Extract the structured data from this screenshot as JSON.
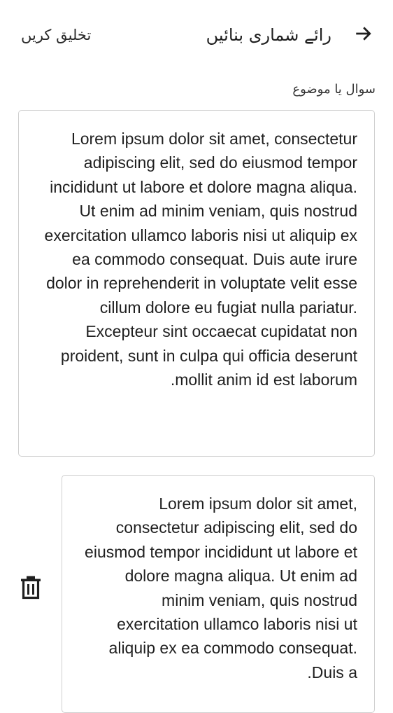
{
  "header": {
    "back_icon": "arrow-right-icon",
    "title": "رائے شماری بنائیں",
    "create_label": "تخلیق کریں"
  },
  "question": {
    "label": "سوال یا موضوع",
    "text": "Lorem ipsum dolor sit amet, consectetur adipiscing elit, sed do eiusmod tempor incididunt ut labore et dolore magna aliqua. Ut enim ad minim veniam, quis nostrud exercitation ullamco laboris nisi ut aliquip ex ea commodo consequat. Duis aute irure dolor in reprehenderit in voluptate velit esse cillum dolore eu fugiat nulla pariatur. Excepteur sint occaecat cupidatat non proident, sunt in culpa qui officia deserunt mollit anim id est laborum."
  },
  "options": [
    {
      "delete_icon": "trash-icon",
      "text": "Lorem ipsum dolor sit amet, consectetur adipiscing elit, sed do eiusmod tempor incididunt ut labore et dolore magna aliqua. Ut enim ad minim veniam, quis nostrud exercitation ullamco laboris nisi ut aliquip ex ea commodo consequat. Duis a."
    }
  ],
  "colors": {
    "text": "#1f1f1f",
    "border": "#cfcfcf",
    "background": "#ffffff"
  }
}
